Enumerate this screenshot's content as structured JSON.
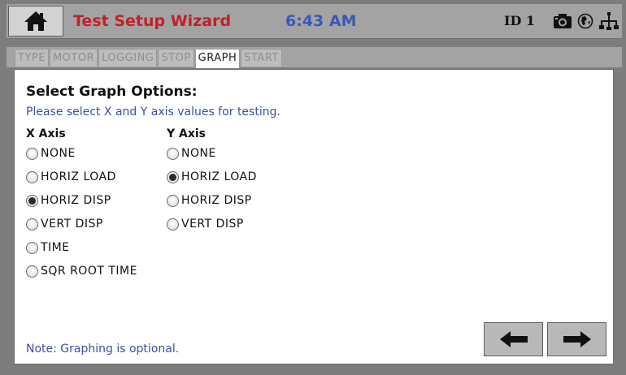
{
  "header": {
    "title": "Test Setup Wizard",
    "time": "6:43 AM",
    "device_id": "ID 1",
    "icons": [
      "home-icon",
      "camera-icon",
      "network-icon",
      "usb-icon"
    ],
    "title_color": "#c21f2b",
    "time_color": "#3b57b5"
  },
  "tabs": [
    {
      "label": "TYPE",
      "active": false
    },
    {
      "label": "MOTOR",
      "active": false
    },
    {
      "label": "LOGGING",
      "active": false
    },
    {
      "label": "STOP",
      "active": false
    },
    {
      "label": "GRAPH",
      "active": true
    },
    {
      "label": "START",
      "active": false
    }
  ],
  "content": {
    "heading": "Select Graph Options:",
    "subtitle": "Please select X and Y axis values for testing.",
    "x_axis": {
      "label": "X Axis",
      "options": [
        "NONE",
        "HORIZ LOAD",
        "HORIZ DISP",
        "VERT DISP",
        "TIME",
        "SQR ROOT TIME"
      ],
      "selected": "HORIZ DISP"
    },
    "y_axis": {
      "label": "Y Axis",
      "options": [
        "NONE",
        "HORIZ LOAD",
        "HORIZ DISP",
        "VERT DISP"
      ],
      "selected": "HORIZ LOAD"
    },
    "note": "Note: Graphing is optional."
  },
  "nav": {
    "back_icon": "left-arrow-icon",
    "next_icon": "right-arrow-icon"
  }
}
